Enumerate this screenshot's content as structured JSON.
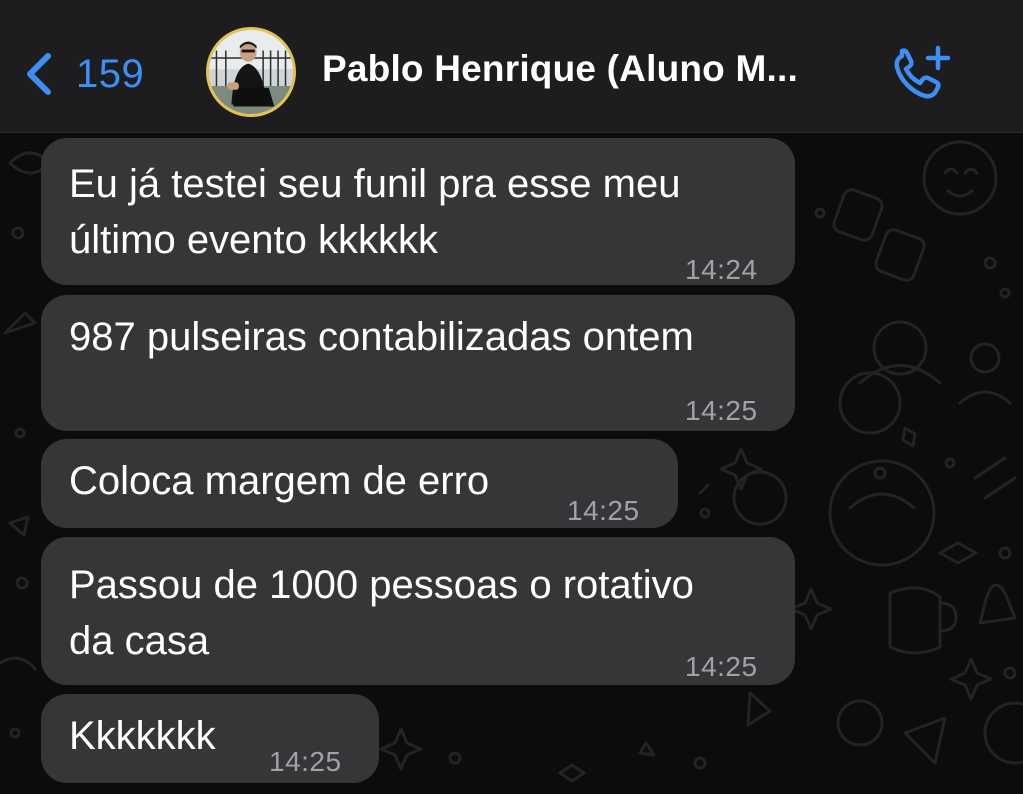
{
  "header": {
    "back_count": "159",
    "contact_name": "Pablo Henrique (Aluno M...",
    "back_icon": "chevron-left-icon",
    "call_icon": "phone-add-icon",
    "accent_color": "#3b8ff5"
  },
  "messages": [
    {
      "line1": "Eu já testei seu funil pra esse meu",
      "line2": "último evento kkkkkk",
      "time": "14:24"
    },
    {
      "line1": "987 pulseiras contabilizadas ontem",
      "line2": "",
      "time": "14:25"
    },
    {
      "line1": "Coloca margem de erro",
      "line2": "",
      "time": "14:25"
    },
    {
      "line1": "Passou de 1000 pessoas o rotativo",
      "line2": "da casa",
      "time": "14:25"
    },
    {
      "line1": "Kkkkkkk",
      "line2": "",
      "time": "14:25"
    }
  ],
  "colors": {
    "bubble": "#363638",
    "timestamp": "#a2a2a6",
    "header_bg": "#1d1d1f"
  }
}
